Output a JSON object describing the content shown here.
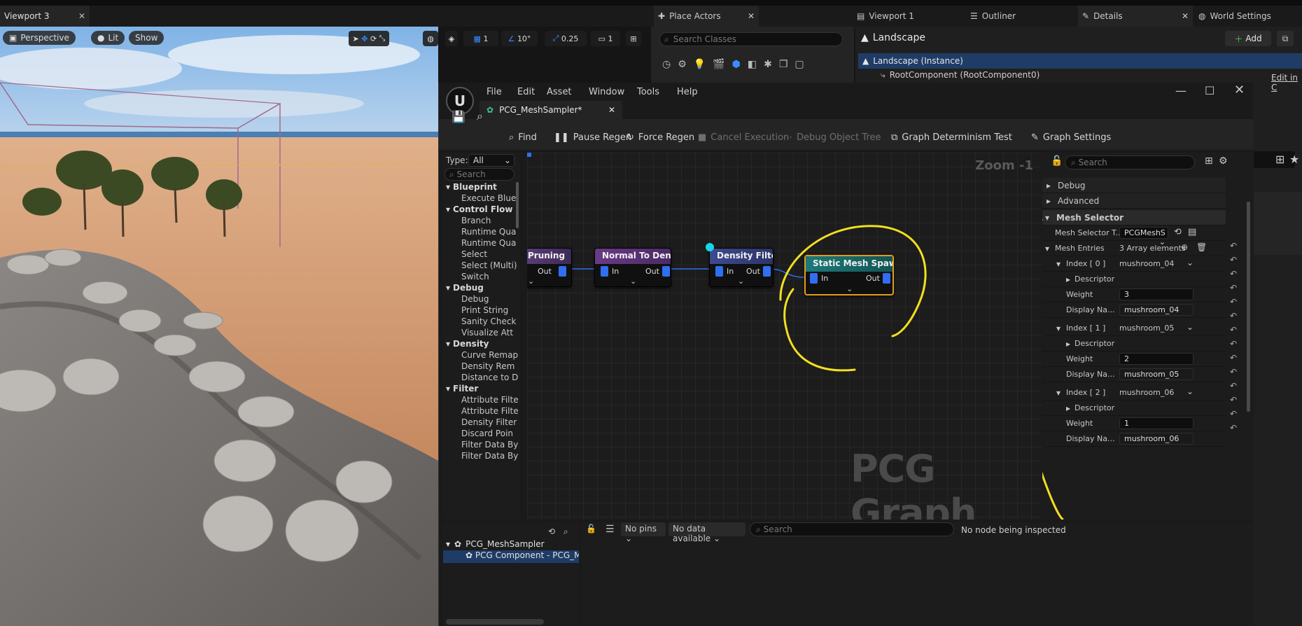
{
  "viewport": {
    "tab_label": "Viewport 3",
    "perspective_label": "Perspective",
    "lit_label": "Lit",
    "show_label": "Show",
    "grid_snap": "1",
    "angle_snap": "10°",
    "scale_snap": "0.25",
    "camera_speed": "1"
  },
  "place_actors": {
    "tab_label": "Place Actors",
    "search_placeholder": "Search Classes"
  },
  "right_tabs": {
    "viewport1": "Viewport 1",
    "outliner": "Outliner",
    "details": "Details",
    "world_settings": "World Settings"
  },
  "details": {
    "actor_name": "Landscape",
    "add_label": "Add",
    "instance_label": "Landscape (Instance)",
    "root_component": "RootComponent (RootComponent0)",
    "edit_in_label": "Edit in C"
  },
  "pcg": {
    "menu": [
      "File",
      "Edit",
      "Asset",
      "Window",
      "Tools",
      "Help"
    ],
    "doc_tab": "PCG_MeshSampler*",
    "toolbar": {
      "find": "Find",
      "pause_regen": "Pause Regen",
      "force_regen": "Force Regen",
      "cancel_execution": "Cancel Execution",
      "debug_object_tree": "Debug Object Tree",
      "graph_determinism": "Graph Determinism Test",
      "graph_settings": "Graph Settings"
    },
    "palette": {
      "type_label": "Type:",
      "type_value": "All",
      "search_placeholder": "Search",
      "categories": [
        {
          "name": "Blueprint",
          "items": [
            "Execute Blue"
          ]
        },
        {
          "name": "Control Flow",
          "items": [
            "Branch",
            "Runtime Qua",
            "Runtime Qua",
            "Select",
            "Select (Multi)",
            "Switch"
          ]
        },
        {
          "name": "Debug",
          "items": [
            "Debug",
            "Print String",
            "Sanity Check",
            "Visualize Att"
          ]
        },
        {
          "name": "Density",
          "items": [
            "Curve Remap",
            "Density Rem",
            "Distance to D"
          ]
        },
        {
          "name": "Filter",
          "items": [
            "Attribute Filte",
            "Attribute Filte",
            "Density Filter",
            "Discard Poin",
            "Filter Data By",
            "Filter Data By"
          ]
        }
      ]
    },
    "graph": {
      "zoom_label": "Zoom -1",
      "watermark": "PCG Graph",
      "nodes": [
        {
          "title": "Pruning",
          "in": "",
          "out": "Out"
        },
        {
          "title": "Normal To Density",
          "in": "In",
          "out": "Out"
        },
        {
          "title": "Density Filter",
          "in": "In",
          "out": "Out"
        },
        {
          "title": "Static Mesh Spawner",
          "in": "In",
          "out": "Out"
        }
      ]
    },
    "details": {
      "search_placeholder": "Search",
      "debug_label": "Debug",
      "advanced_label": "Advanced",
      "mesh_selector_section": "Mesh Selector",
      "mesh_selector_type_label": "Mesh Selector T...",
      "mesh_selector_type_value": "PCGMeshS",
      "mesh_entries_label": "Mesh Entries",
      "mesh_entries_value": "3 Array elements",
      "entries": [
        {
          "index": "Index [ 0 ]",
          "mesh": "mushroom_04",
          "descriptor": "Descriptor",
          "weight_label": "Weight",
          "weight": "3",
          "display_label": "Display Na...",
          "display_name": "mushroom_04"
        },
        {
          "index": "Index [ 1 ]",
          "mesh": "mushroom_05",
          "descriptor": "Descriptor",
          "weight_label": "Weight",
          "weight": "2",
          "display_label": "Display Na...",
          "display_name": "mushroom_05"
        },
        {
          "index": "Index [ 2 ]",
          "mesh": "mushroom_06",
          "descriptor": "Descriptor",
          "weight_label": "Weight",
          "weight": "1",
          "display_label": "Display Na...",
          "display_name": "mushroom_06"
        }
      ]
    },
    "debug_tree": {
      "root": "PCG_MeshSampler",
      "child": "PCG Component - PCG_MeshS"
    },
    "inspector": {
      "pins_filter": "No pins",
      "data_filter": "No data available",
      "search_placeholder": "Search",
      "status": "No node being inspected"
    }
  },
  "colors": {
    "accent_yellow": "#f2df1f",
    "pin_blue": "#2f6ff0",
    "selected_blue": "#1f3c66"
  }
}
